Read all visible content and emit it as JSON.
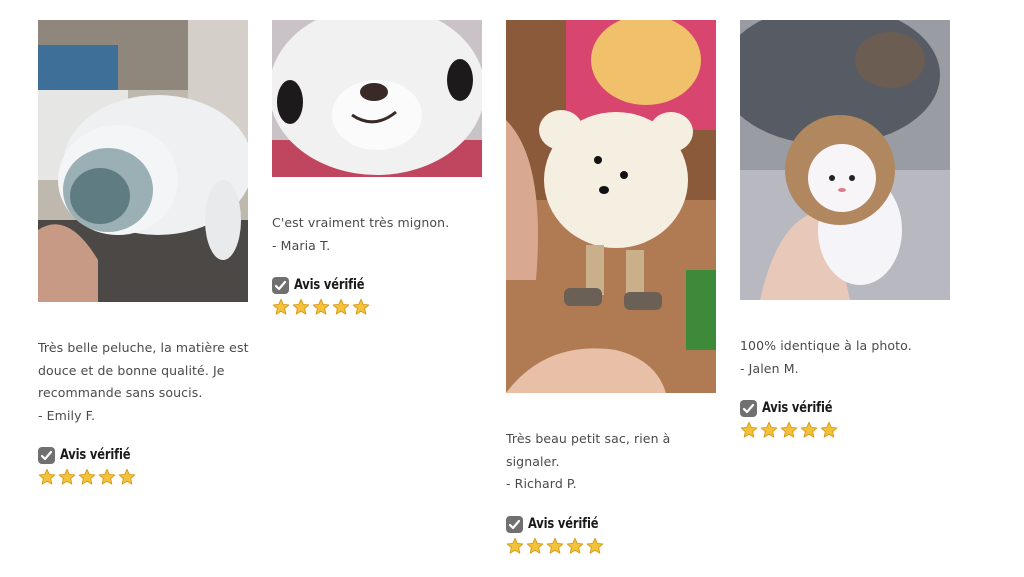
{
  "reviews": [
    {
      "text_lines": [
        "Très belle peluche, la matière est",
        "douce et de bonne qualité. Je",
        "recommande sans soucis."
      ],
      "author": "- Emily F.",
      "verified_label": "Avis vérifié",
      "rating": 5,
      "photo_icon": "seal-plush-photo"
    },
    {
      "text_lines": [
        "C'est vraiment très mignon."
      ],
      "author": "- Maria T.",
      "verified_label": "Avis vérifié",
      "rating": 5,
      "photo_icon": "seal-face-plush-photo"
    },
    {
      "text_lines": [
        "Très beau petit sac, rien à",
        "signaler."
      ],
      "author": "- Richard P.",
      "verified_label": "Avis vérifié",
      "rating": 5,
      "photo_icon": "bear-bag-photo"
    },
    {
      "text_lines": [
        "100% identique à la photo."
      ],
      "author": "- Jalen M.",
      "verified_label": "Avis vérifié",
      "rating": 5,
      "photo_icon": "cat-plush-photo"
    }
  ],
  "colors": {
    "star": "#f3c13a",
    "star_outline": "#d69a17",
    "check_box": "#707070",
    "text": "#4a4a4a"
  },
  "icons": {
    "verified": "checkmark-icon",
    "rating": "star-icon"
  }
}
